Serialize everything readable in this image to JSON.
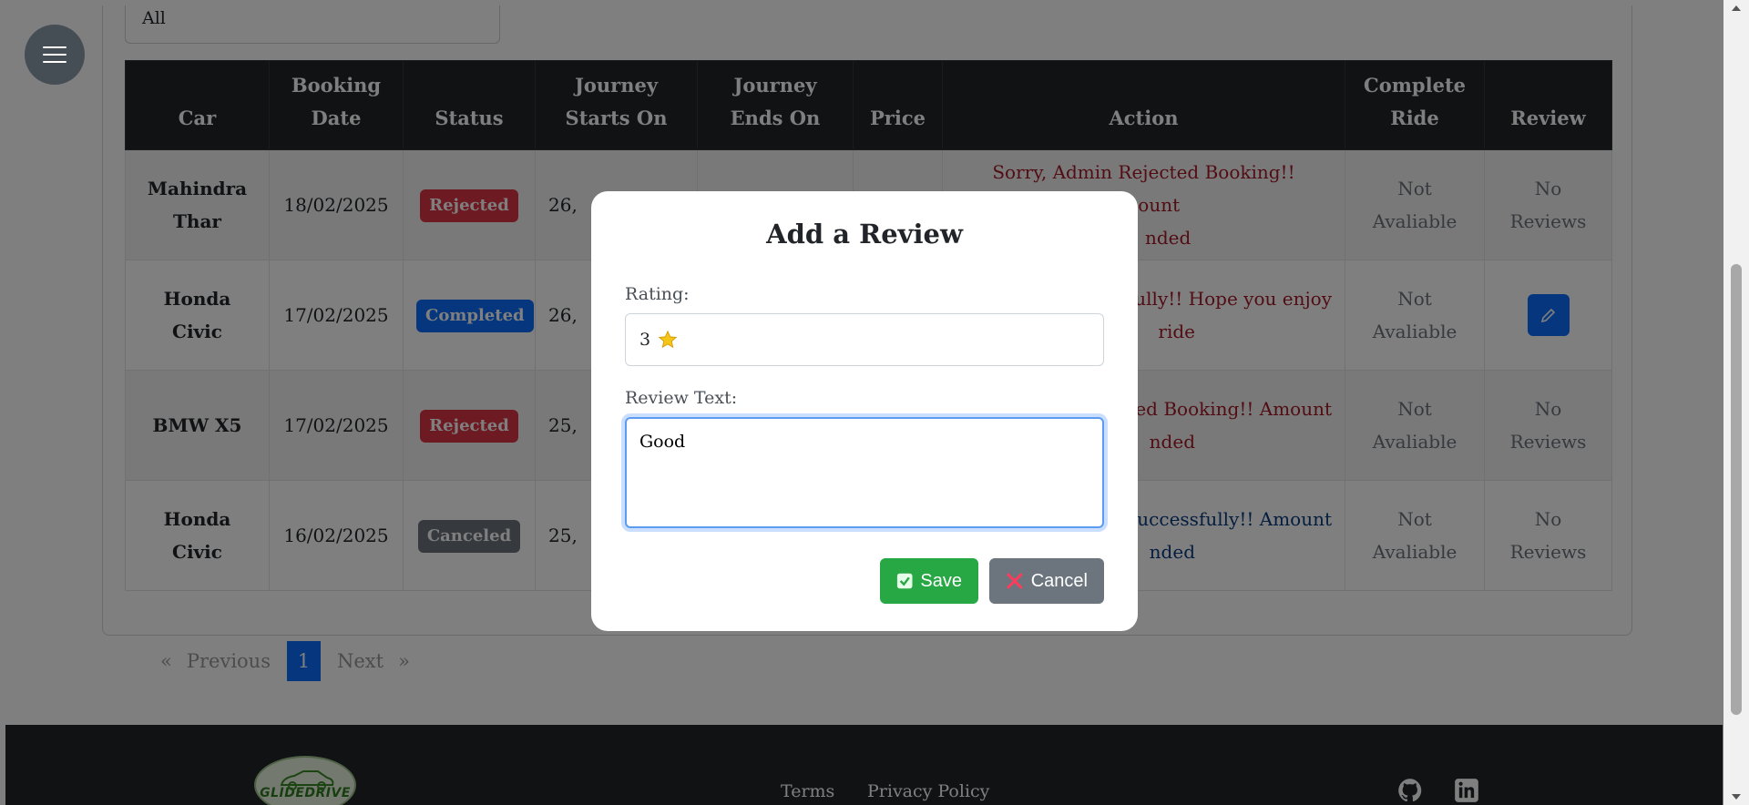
{
  "filter": {
    "value": "All"
  },
  "table": {
    "headers": [
      "Car",
      "Booking Date",
      "Status",
      "Journey Starts On",
      "Journey Ends On",
      "Price",
      "Action",
      "Complete Ride",
      "Review"
    ],
    "rows": [
      {
        "car": "Mahindra Thar",
        "date": "18/02/2025",
        "status": "Rejected",
        "starts": "26,",
        "action_line1": "Sorry, Admin Rejected Booking!! Amount",
        "action_line2": "nded",
        "complete": "Not Avaliable",
        "review": "No Reviews"
      },
      {
        "car": "Honda Civic",
        "date": "17/02/2025",
        "status": "Completed",
        "starts": "26,",
        "action_line1": "sfully!! Hope you enjoy",
        "action_line2": "ride",
        "complete": "Not Avaliable",
        "review": ""
      },
      {
        "car": "BMW X5",
        "date": "17/02/2025",
        "status": "Rejected",
        "starts": "25,",
        "action_line1": "ed Booking!! Amount",
        "action_line2": "nded",
        "complete": "Not Avaliable",
        "review": "No Reviews"
      },
      {
        "car": "Honda Civic",
        "date": "16/02/2025",
        "status": "Canceled",
        "starts": "25,",
        "action_line1": "uccessfully!! Amount",
        "action_line2": "nded",
        "complete": "Not Avaliable",
        "review": "No Reviews"
      }
    ]
  },
  "pagination": {
    "prev_symbol": "«",
    "prev": "Previous",
    "current": "1",
    "next": "Next",
    "next_symbol": "»"
  },
  "footer": {
    "logo_text": "GLIDEDRIVE",
    "terms": "Terms",
    "privacy": "Privacy Policy",
    "icons": [
      "github-icon",
      "linkedin-icon"
    ]
  },
  "modal": {
    "title": "Add a Review",
    "rating_label": "Rating:",
    "rating_value": "3",
    "review_label": "Review Text:",
    "review_value": "Good",
    "save": "Save",
    "cancel": "Cancel"
  },
  "colors": {
    "rejected": "#dc3545",
    "completed": "#0d6efd",
    "canceled": "#6c757d",
    "save": "#28a745",
    "header": "#212529"
  }
}
